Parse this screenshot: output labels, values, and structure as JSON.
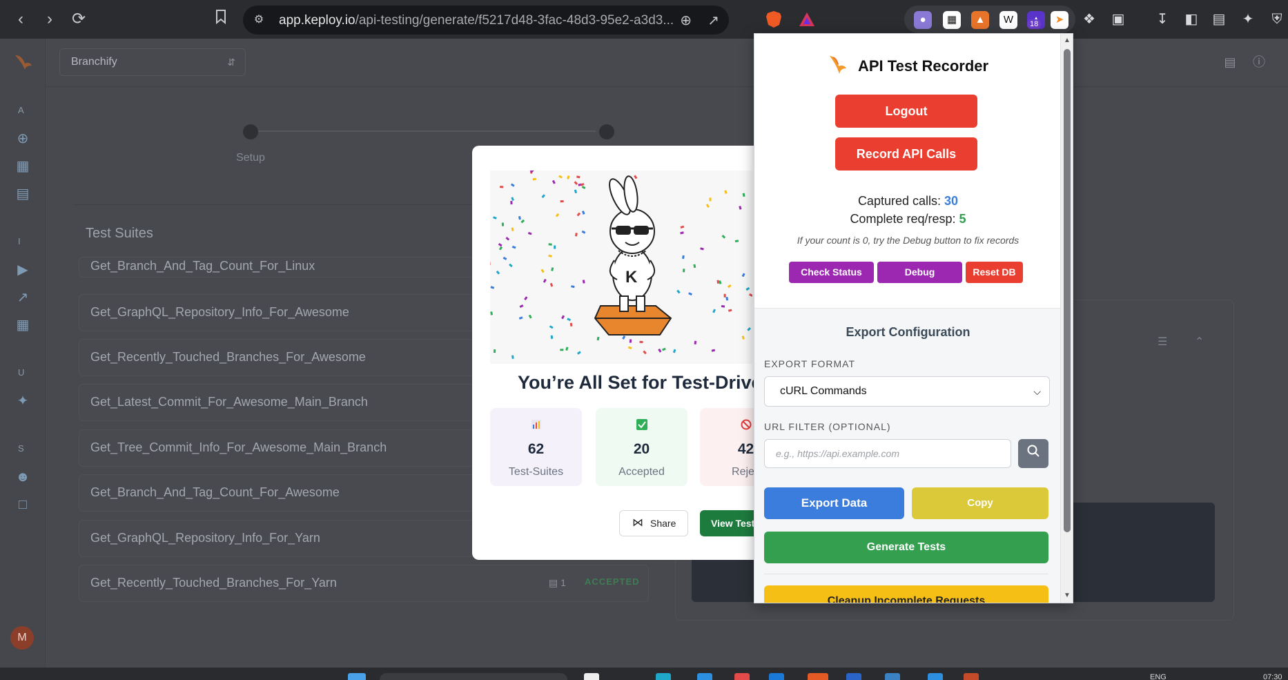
{
  "browser": {
    "url_host": "app.keploy.io",
    "url_path": "/api-testing/generate/f5217d48-3fac-48d3-95e2-a3d3...",
    "extension_badge": "18"
  },
  "app": {
    "project": "Branchify",
    "rail_letters": [
      "A",
      "I",
      "U",
      "S"
    ],
    "avatar_initial": "M",
    "stepper": {
      "step1_label": "Setup"
    },
    "suites_title": "Test Suites",
    "suites": [
      {
        "name": "Get_Branch_And_Tag_Count_For_Linux"
      },
      {
        "name": "Get_GraphQL_Repository_Info_For_Awesome"
      },
      {
        "name": "Get_Recently_Touched_Branches_For_Awesome"
      },
      {
        "name": "Get_Latest_Commit_For_Awesome_Main_Branch"
      },
      {
        "name": "Get_Tree_Commit_Info_For_Awesome_Main_Branch"
      },
      {
        "name": "Get_Branch_And_Tag_Count_For_Awesome"
      },
      {
        "name": "Get_GraphQL_Repository_Info_For_Yarn"
      },
      {
        "name": "Get_Recently_Touched_Branches_For_Yarn",
        "count": "1",
        "status": "ACCEPTED"
      }
    ]
  },
  "modal": {
    "title": "You’re All Set for Test-Drive",
    "stats": [
      {
        "icon": "chart-icon",
        "value": "62",
        "label": "Test-Suites"
      },
      {
        "icon": "check-icon",
        "value": "20",
        "label": "Accepted"
      },
      {
        "icon": "prohibited-icon",
        "value": "42",
        "label": "Rejec"
      }
    ],
    "share_label": "Share",
    "view_label": "View Test"
  },
  "popup": {
    "title": "API Test Recorder",
    "logout_label": "Logout",
    "record_label": "Record API Calls",
    "captured_label": "Captured calls:",
    "captured_value": "30",
    "complete_label": "Complete req/resp:",
    "complete_value": "5",
    "hint": "If your count is 0, try the Debug button to fix records",
    "check_status_label": "Check Status",
    "debug_label": "Debug",
    "reset_db_label": "Reset DB",
    "export_title": "Export Configuration",
    "format_label": "EXPORT FORMAT",
    "format_value": "cURL Commands",
    "filter_label": "URL FILTER (OPTIONAL)",
    "filter_placeholder": "e.g., https://api.example.com",
    "export_data_label": "Export Data",
    "copy_label": "Copy",
    "generate_label": "Generate Tests",
    "cleanup_label": "Cleanup Incomplete Requests",
    "colors": {
      "red": "#ea3e30",
      "purple": "#9c27b0",
      "blue": "#3b7ddd",
      "yellow": "#dcc93a",
      "green": "#34a04f",
      "amber": "#f6bf16",
      "captured": "#3b7ddd",
      "complete": "#2e9e4a"
    }
  },
  "taskbar": {
    "lang": "ENG",
    "time": "07:30"
  }
}
